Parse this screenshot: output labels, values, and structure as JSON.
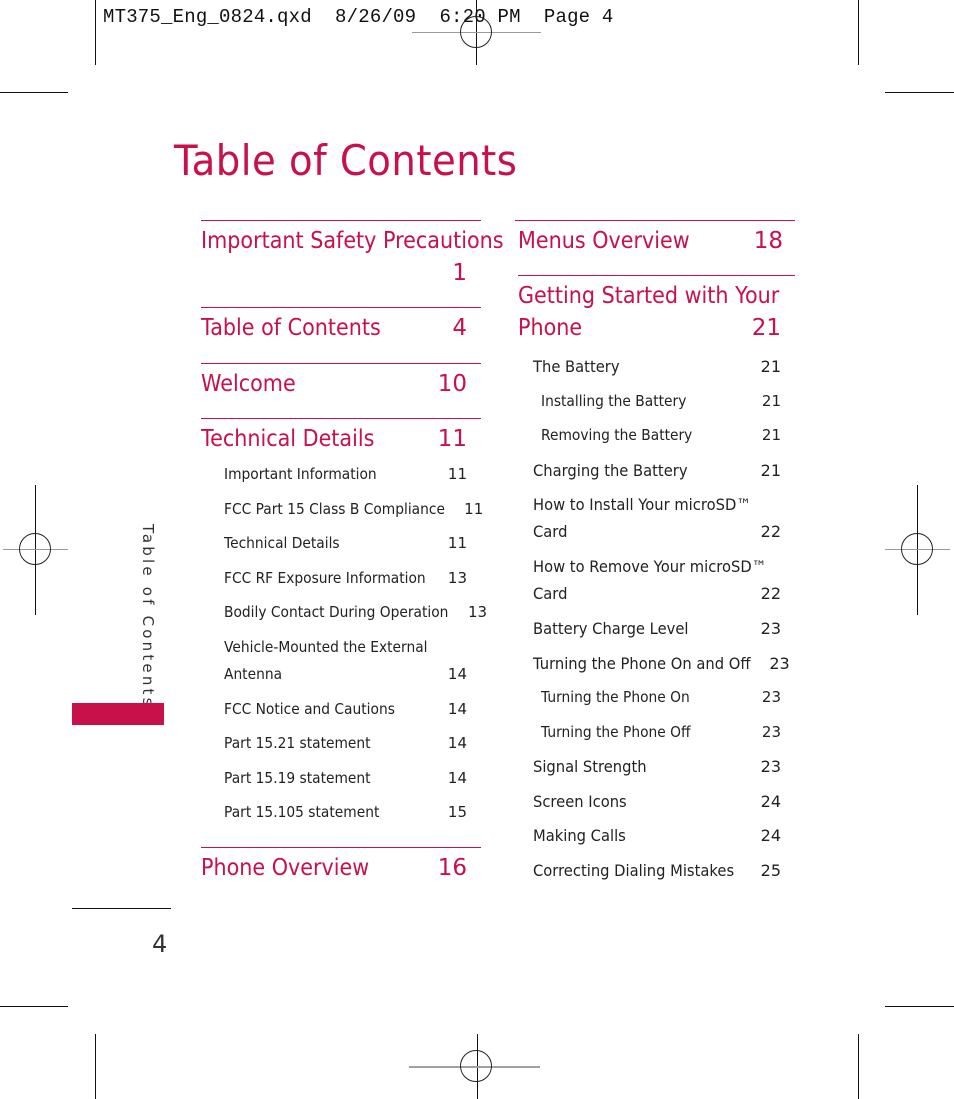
{
  "slug": "MT375_Eng_0824.qxd  8/26/09  6:20 PM  Page 4",
  "title": "Table of Contents",
  "side_tab": {
    "label": "Table of Contents",
    "color": "#c8104a"
  },
  "page_number": "4",
  "accent_color": "#c8104a",
  "left_column": {
    "sections": [
      {
        "label": "Important Safety Precautions",
        "page": "1"
      },
      {
        "label": "Table of Contents",
        "page": "4"
      },
      {
        "label": "Welcome",
        "page": "10"
      },
      {
        "label": "Technical Details",
        "page": "11",
        "items": [
          {
            "label": "Important Information",
            "page": "11"
          },
          {
            "label": "FCC Part  15 Class B Compliance",
            "page": "11"
          },
          {
            "label": "Technical Details",
            "page": "11"
          },
          {
            "label": "FCC RF Exposure Information",
            "page": "13"
          },
          {
            "label": "Bodily Contact During Operation",
            "page": "13"
          },
          {
            "label_line1": "Vehicle-Mounted the External",
            "label_line2": "Antenna",
            "page": "14"
          },
          {
            "label": "FCC Notice and Cautions",
            "page": "14"
          },
          {
            "label": "Part 15.21 statement",
            "page": "14"
          },
          {
            "label": "Part 15.19 statement",
            "page": "14"
          },
          {
            "label": "Part 15.105 statement",
            "page": "15"
          }
        ]
      },
      {
        "label": "Phone Overview",
        "page": "16"
      }
    ]
  },
  "right_column": {
    "sections": [
      {
        "label": "Menus Overview",
        "page": "18"
      },
      {
        "label_line1": "Getting Started with Your",
        "label_line2": "Phone",
        "page": "21",
        "items": [
          {
            "label": "The Battery",
            "page": "21"
          },
          {
            "label": "Installing the Battery",
            "page": "21"
          },
          {
            "label": "Removing the Battery",
            "page": "21"
          },
          {
            "label": "Charging the Battery",
            "page": "21"
          },
          {
            "label_line1": "How to Install Your microSD™",
            "label_line2": "Card",
            "page": "22"
          },
          {
            "label_line1": "How to Remove Your microSD™",
            "label_line2": "Card",
            "page": "22"
          },
          {
            "label": "Battery Charge Level",
            "page": "23"
          },
          {
            "label": "Turning the Phone On and Off",
            "page": "23"
          },
          {
            "label": "Turning the Phone On",
            "page": "23"
          },
          {
            "label": "Turning the Phone Off",
            "page": "23"
          },
          {
            "label": "Signal Strength",
            "page": "23"
          },
          {
            "label": "Screen Icons",
            "page": "24"
          },
          {
            "label": "Making Calls",
            "page": "24"
          },
          {
            "label": "Correcting Dialing Mistakes",
            "page": "25"
          }
        ]
      }
    ]
  }
}
